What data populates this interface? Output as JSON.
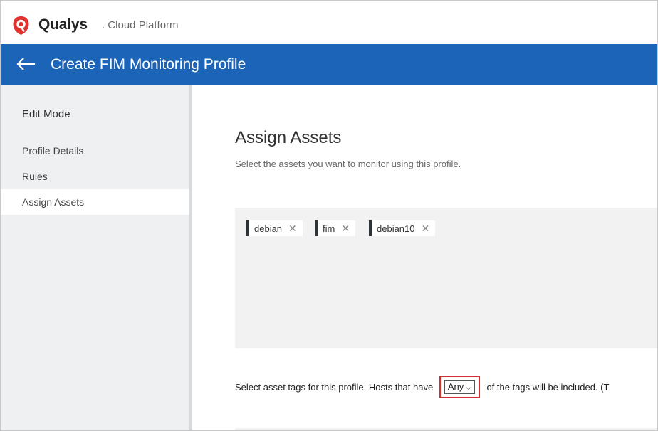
{
  "brand": {
    "name": "Qualys",
    "suffix": ". Cloud Platform",
    "color": "#e0312c"
  },
  "header": {
    "title": "Create FIM Monitoring Profile",
    "back_icon": "arrow-left-icon",
    "bg_color": "#1b64b8"
  },
  "sidebar": {
    "heading": "Edit Mode",
    "items": [
      {
        "label": "Profile Details"
      },
      {
        "label": "Rules"
      },
      {
        "label": "Assign Assets",
        "active": true
      }
    ]
  },
  "main": {
    "title": "Assign Assets",
    "subtitle": "Select the assets you want to monitor using this profile.",
    "tags": [
      {
        "label": "debian"
      },
      {
        "label": "fim"
      },
      {
        "label": "debian10"
      }
    ],
    "remove_icon": "close-icon",
    "tag_instruction_before": "Select asset tags for this profile. Hosts that have",
    "match_select_value": "Any",
    "tag_instruction_after": "of the tags will be included. (T"
  }
}
